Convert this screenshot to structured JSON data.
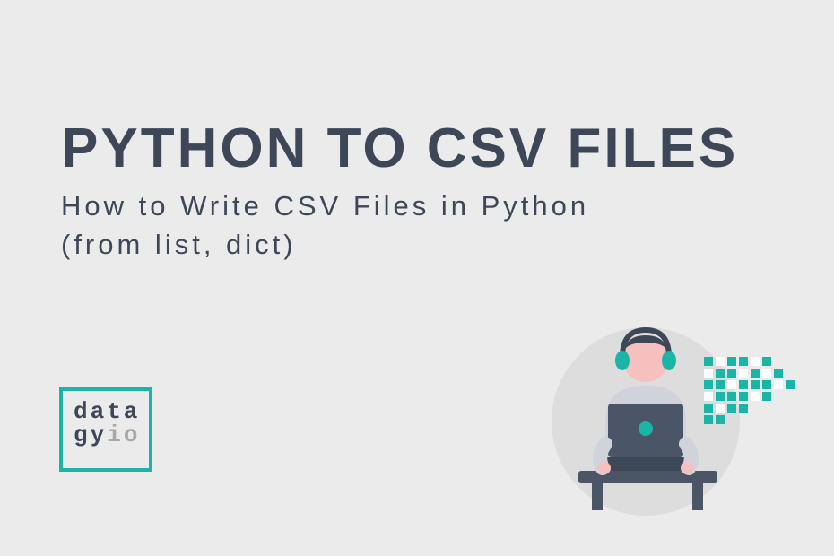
{
  "title": "PYTHON TO CSV FILES",
  "subtitle_line1": "How to Write CSV Files in Python",
  "subtitle_line2": "(from list, dict)",
  "logo": {
    "line1": "data",
    "line2a": "gy",
    "line2b": "io"
  },
  "colors": {
    "background": "#ebebeb",
    "text": "#3e4757",
    "accent": "#1ab5a7",
    "muted": "#a8a8a8"
  }
}
